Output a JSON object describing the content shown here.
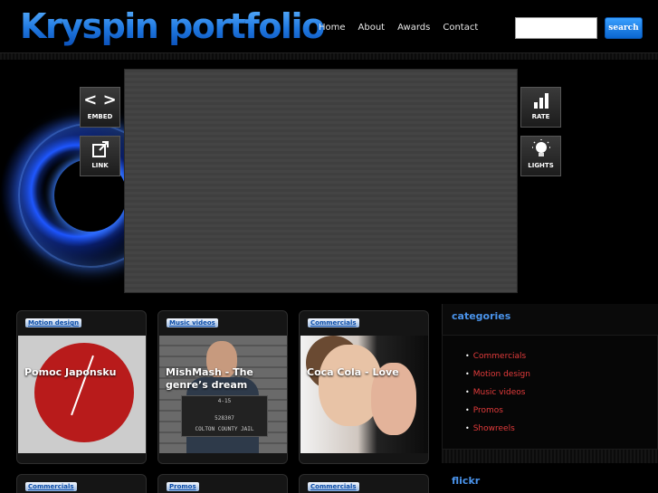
{
  "header": {
    "logo": "Kryspin portfolio",
    "nav": [
      "Home",
      "About",
      "Awards",
      "Contact"
    ],
    "search_placeholder": "",
    "search_button": "search"
  },
  "player": {
    "left_buttons": [
      {
        "icon": "embed-icon",
        "label": "EMBED"
      },
      {
        "icon": "link-icon",
        "label": "LINK"
      }
    ],
    "right_buttons": [
      {
        "icon": "rate-icon",
        "label": "RATE"
      },
      {
        "icon": "lightbulb-icon",
        "label": "LIGHTS"
      }
    ]
  },
  "cards": [
    {
      "tag": "Motion design",
      "title": "Pomoc Japonsku"
    },
    {
      "tag": "Music videos",
      "title": "MishMash - The genre’s dream"
    },
    {
      "tag": "Commercials",
      "title": "Coca Cola - Love"
    }
  ],
  "cards_row2": [
    {
      "tag": "Commercials"
    },
    {
      "tag": "Promos"
    },
    {
      "tag": "Commercials"
    }
  ],
  "mugshot_board": "COLTON COUNTY JAIL",
  "mugshot_number": "528307",
  "mugshot_date": "4-15",
  "sidebar": {
    "categories_heading": "categories",
    "categories": [
      "Commercials",
      "Motion design",
      "Music videos",
      "Promos",
      "Showreels"
    ],
    "flickr_heading": "flickr"
  },
  "colors": {
    "accent": "#4a93ea",
    "category_link": "#e23b3b",
    "logo": "#1f78e0"
  }
}
